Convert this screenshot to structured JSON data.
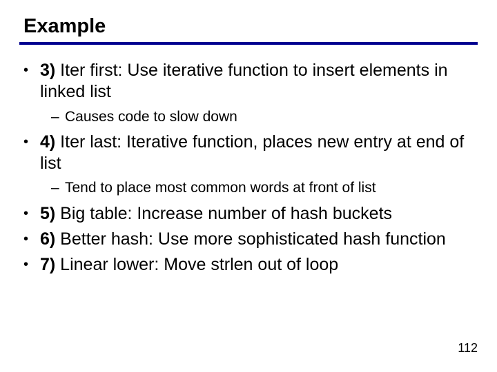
{
  "title": "Example",
  "items": [
    {
      "num": "3)",
      "text": " Iter first: Use iterative function to insert elements in linked list",
      "sub": [
        {
          "text": "Causes code to slow down"
        }
      ]
    },
    {
      "num": "4)",
      "text": " Iter last: Iterative function, places new entry at end of list",
      "sub": [
        {
          "text": "Tend to place most common words at front of list"
        }
      ]
    },
    {
      "num": "5)",
      "text": " Big table: Increase number of hash buckets",
      "sub": []
    },
    {
      "num": "6)",
      "text": " Better hash: Use more sophisticated hash function",
      "sub": []
    },
    {
      "num": "7)",
      "text": " Linear lower: Move strlen out of loop",
      "sub": []
    }
  ],
  "bullet_char": "•",
  "dash_char": "–",
  "page_number": "112"
}
